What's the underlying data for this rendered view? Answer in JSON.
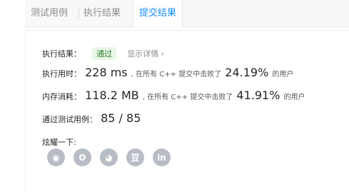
{
  "tabs": [
    {
      "label": "测试用例"
    },
    {
      "label": "执行结果"
    },
    {
      "label": "提交结果"
    }
  ],
  "result": {
    "label": "执行结果：",
    "status": "通过",
    "detail_link": "显示详情 ›"
  },
  "runtime": {
    "label": "执行用时：",
    "value": "228 ms",
    "text_before": ", 在所有 C++ 提交中击败了",
    "percent": "24.19%",
    "text_after": "的用户"
  },
  "memory": {
    "label": "内存消耗：",
    "value": "118.2 MB",
    "text_before": ", 在所有 C++ 提交中击败了",
    "percent": "41.91%",
    "text_after": "的用户"
  },
  "testcases": {
    "label": "通过测试用例：",
    "value": "85 / 85"
  },
  "share": {
    "label": "炫耀一下:",
    "icons": [
      "wechat-icon",
      "weibo-icon",
      "qq-icon",
      "douban-icon",
      "linkedin-icon"
    ],
    "glyphs": [
      "◉",
      "ʘ",
      "◕",
      "豆",
      "in"
    ]
  },
  "colors": {
    "accent": "#1a90ff",
    "success_bg": "#e8f7e8",
    "success_text": "#2e7d32",
    "icon_gray": "#b8bcc4"
  }
}
